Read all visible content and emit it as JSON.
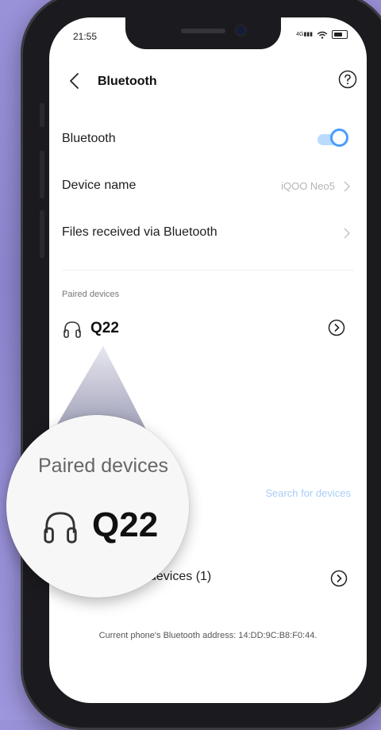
{
  "status_bar": {
    "time": "21:55",
    "signal_text": "4G"
  },
  "header": {
    "title": "Bluetooth"
  },
  "settings": {
    "bluetooth_label": "Bluetooth",
    "bluetooth_enabled": true,
    "device_name_label": "Device name",
    "device_name_value": "iQOO Neo5",
    "files_label": "Files received via Bluetooth"
  },
  "paired": {
    "section_label": "Paired devices",
    "devices": [
      {
        "name": "Q22",
        "icon": "headphone-icon"
      }
    ]
  },
  "available": {
    "search_label": "Search for devices",
    "label": "devices (1)"
  },
  "footer": {
    "address": "Current phone's Bluetooth address: 14:DD:9C:B8:F0:44."
  },
  "magnifier": {
    "section_label": "Paired devices",
    "device_name": "Q22"
  },
  "colors": {
    "toggle_on": "#4a9cff",
    "link": "#a9cdf6",
    "background": "#9a92d9"
  }
}
